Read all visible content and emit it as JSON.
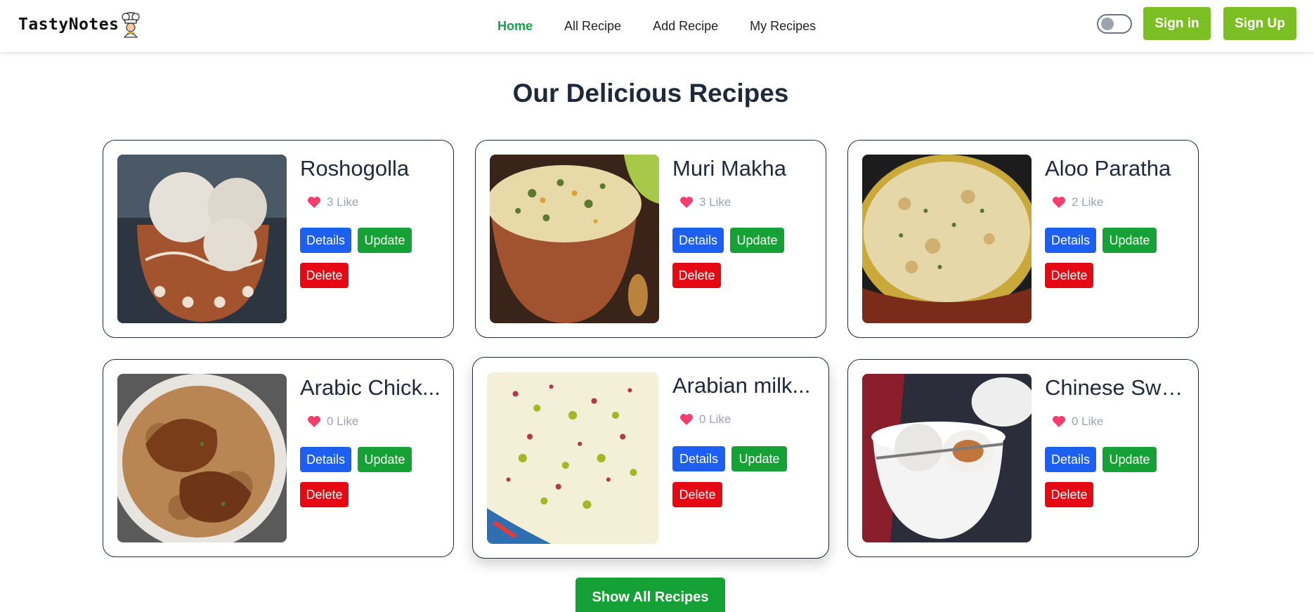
{
  "brand": {
    "name": "TastyNotes",
    "logo_icon": "chef-icon"
  },
  "nav": {
    "links": [
      {
        "label": "Home",
        "active": true
      },
      {
        "label": "All Recipe",
        "active": false
      },
      {
        "label": "Add Recipe",
        "active": false
      },
      {
        "label": "My Recipes",
        "active": false
      }
    ],
    "theme_toggle": {
      "state": "off"
    },
    "sign_in_label": "Sign in",
    "sign_up_label": "Sign Up"
  },
  "page_title": "Our Delicious Recipes",
  "recipes": [
    {
      "title": "Roshogolla",
      "likes": "3 Like",
      "image": "roshogolla-photo"
    },
    {
      "title": "Muri Makha",
      "likes": "3 Like",
      "image": "muri-makha-photo"
    },
    {
      "title": "Aloo Paratha",
      "likes": "2 Like",
      "image": "aloo-paratha-photo"
    },
    {
      "title": "Arabic Chick...",
      "likes": "0 Like",
      "image": "arabic-chicken-photo"
    },
    {
      "title": "Arabian milk...",
      "likes": "0 Like",
      "image": "arabian-milk-photo"
    },
    {
      "title": "Chinese Swe...",
      "likes": "0 Like",
      "image": "chinese-sweet-photo"
    }
  ],
  "card_buttons": {
    "details": "Details",
    "update": "Update",
    "delete": "Delete"
  },
  "show_all_label": "Show All Recipes",
  "colors": {
    "active_nav": "#16a34a",
    "auth_button": "#7cbf24",
    "details_button": "#1d5ff0",
    "update_button": "#15a135",
    "delete_button": "#e50914",
    "heart": "#f43f6e"
  }
}
